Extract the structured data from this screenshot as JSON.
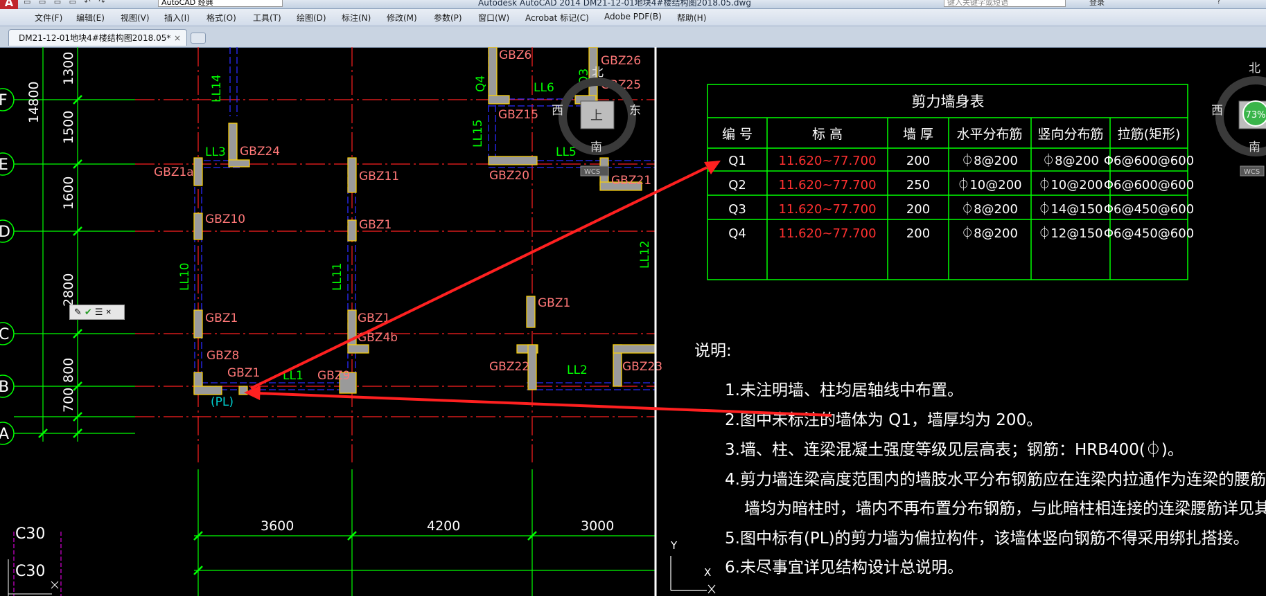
{
  "titlebar": {
    "logo": "A",
    "workspace": "AutoCAD 经典",
    "app_title": "Autodesk AutoCAD 2014    DM21-12-01地块4#楼结构图2018.05.dwg",
    "search_placeholder": "键入关键字或短语",
    "login": "登录",
    "help": "?"
  },
  "menu": [
    "文件(F)",
    "编辑(E)",
    "视图(V)",
    "插入(I)",
    "格式(O)",
    "工具(T)",
    "绘图(D)",
    "标注(N)",
    "修改(M)",
    "参数(P)",
    "窗口(W)",
    "Acrobat 标记(C)",
    "Adobe PDF(B)",
    "帮助(H)"
  ],
  "tab": {
    "label": "DM21-12-01地块4#楼结构图2018.05*",
    "close": "×"
  },
  "left_view": {
    "axes": [
      "F",
      "E",
      "D",
      "C",
      "B",
      "A"
    ],
    "total_dim": "14800",
    "dims_vertical": [
      "1300",
      "1500",
      "1600",
      "2800",
      "800",
      "700"
    ],
    "dims_horizontal": [
      "3600",
      "4200",
      "3000"
    ],
    "green_labels": [
      "LL14",
      "LL3",
      "LL6",
      "LL5",
      "LL15",
      "LL10",
      "LL11",
      "LL1",
      "LL2",
      "LL12",
      "Q4",
      "Q3"
    ],
    "pink_labels": [
      "GBZ6",
      "GBZ26",
      "GBZ25",
      "GBZ15",
      "GBZ24",
      "GBZ1a",
      "GBZ11",
      "GBZ20",
      "GBZ21",
      "GBZ10",
      "GBZ1",
      "GBZ1",
      "GBZ1",
      "GBZ4b",
      "GBZ1",
      "GBZ8",
      "GBZ1",
      "GBZ9",
      "GBZ22",
      "GBZ23"
    ],
    "pl_tag": "(PL)",
    "concrete": [
      "C30",
      "C30"
    ],
    "compass": {
      "n": "北",
      "s": "南",
      "e": "东",
      "w": "西",
      "center": "上",
      "wcs": "WCS"
    }
  },
  "right_view": {
    "table": {
      "title": "剪力墙身表",
      "headers": [
        "编 号",
        "标 高",
        "墙 厚",
        "水平分布筋",
        "竖向分布筋",
        "拉筋(矩形)"
      ],
      "rows": [
        [
          "Q1",
          "11.620~77.700",
          "200",
          "⏀8@200",
          "⏀8@200",
          "Φ6@600@600"
        ],
        [
          "Q2",
          "11.620~77.700",
          "250",
          "⏀10@200",
          "⏀10@200",
          "Φ6@600@600"
        ],
        [
          "Q3",
          "11.620~77.700",
          "200",
          "⏀8@200",
          "⏀14@150",
          "Φ6@450@600"
        ],
        [
          "Q4",
          "11.620~77.700",
          "200",
          "⏀8@200",
          "⏀12@150",
          "Φ6@450@600"
        ]
      ]
    },
    "notes_title": "说明:",
    "notes": [
      "1.未注明墙、柱均居轴线中布置。",
      "2.图中未标注的墙体为 Q1，墙厚均为 200。",
      "3.墙、柱、连梁混凝土强度等级见层高表；钢筋：HRB400(⏀)。",
      "4.剪力墙连梁高度范围内的墙肢水平分布钢筋应在连梁内拉通作为连梁的腰筋",
      "墙均为暗柱时，墙内不再布置分布钢筋，与此暗柱相连接的连梁腰筋详见其",
      "5.图中标有(PL)的剪力墙为偏拉构件，该墙体竖向钢筋不得采用绑扎搭接。",
      "6.未尽事宜详见结构设计总说明。"
    ],
    "compass": {
      "n": "北",
      "s": "南",
      "w": "西",
      "zoom": "73%",
      "wcs": "WCS"
    },
    "ucs": {
      "y": "Y",
      "x": "X"
    }
  }
}
